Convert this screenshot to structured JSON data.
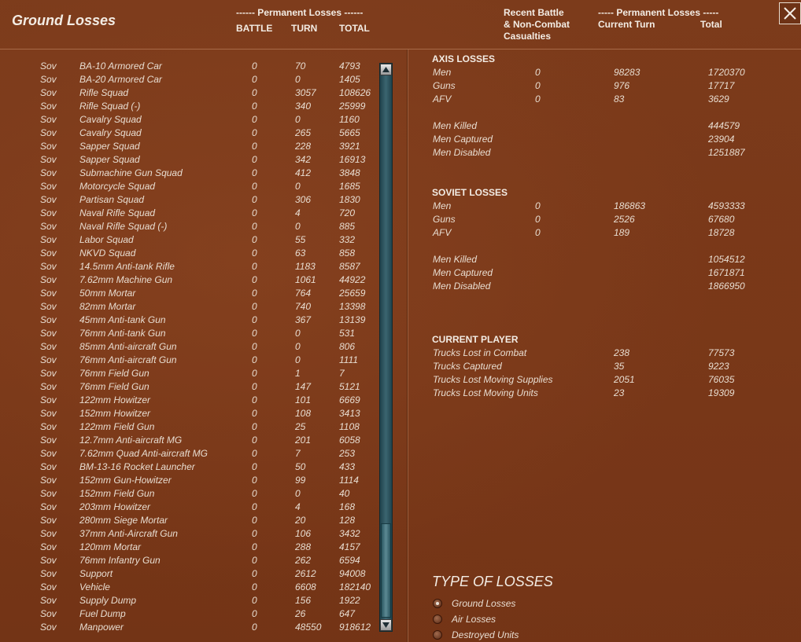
{
  "header": {
    "title": "Ground Losses",
    "perm_losses_label": "------ Permanent Losses ------",
    "col_battle": "BATTLE",
    "col_turn": "TURN",
    "col_total": "TOTAL",
    "recent_battle_line1": "Recent Battle",
    "recent_battle_line2": "& Non-Combat",
    "recent_battle_line3": "Casualties",
    "perm_losses_right": "----- Permanent Losses -----",
    "current_turn": "Current Turn",
    "total": "Total"
  },
  "close_icon": "close-x-icon",
  "units": [
    [
      "Sov",
      "BA-10 Armored Car",
      "0",
      "70",
      "4793"
    ],
    [
      "Sov",
      "BA-20 Armored Car",
      "0",
      "0",
      "1405"
    ],
    [
      "Sov",
      "Rifle Squad",
      "0",
      "3057",
      "108626"
    ],
    [
      "Sov",
      "Rifle Squad (-)",
      "0",
      "340",
      "25999"
    ],
    [
      "Sov",
      "Cavalry Squad",
      "0",
      "0",
      "1160"
    ],
    [
      "Sov",
      "Cavalry Squad",
      "0",
      "265",
      "5665"
    ],
    [
      "Sov",
      "Sapper Squad",
      "0",
      "228",
      "3921"
    ],
    [
      "Sov",
      "Sapper Squad",
      "0",
      "342",
      "16913"
    ],
    [
      "Sov",
      "Submachine Gun Squad",
      "0",
      "412",
      "3848"
    ],
    [
      "Sov",
      "Motorcycle Squad",
      "0",
      "0",
      "1685"
    ],
    [
      "Sov",
      "Partisan Squad",
      "0",
      "306",
      "1830"
    ],
    [
      "Sov",
      "Naval Rifle Squad",
      "0",
      "4",
      "720"
    ],
    [
      "Sov",
      "Naval Rifle Squad (-)",
      "0",
      "0",
      "885"
    ],
    [
      "Sov",
      "Labor Squad",
      "0",
      "55",
      "332"
    ],
    [
      "Sov",
      "NKVD Squad",
      "0",
      "63",
      "858"
    ],
    [
      "Sov",
      "14.5mm Anti-tank Rifle",
      "0",
      "1183",
      "8587"
    ],
    [
      "Sov",
      "7.62mm Machine Gun",
      "0",
      "1061",
      "44922"
    ],
    [
      "Sov",
      "50mm Mortar",
      "0",
      "764",
      "25659"
    ],
    [
      "Sov",
      "82mm Mortar",
      "0",
      "740",
      "13398"
    ],
    [
      "Sov",
      "45mm Anti-tank Gun",
      "0",
      "367",
      "13139"
    ],
    [
      "Sov",
      "76mm Anti-tank Gun",
      "0",
      "0",
      "531"
    ],
    [
      "Sov",
      "85mm Anti-aircraft Gun",
      "0",
      "0",
      "806"
    ],
    [
      "Sov",
      "76mm Anti-aircraft Gun",
      "0",
      "0",
      "1111"
    ],
    [
      "Sov",
      "76mm Field Gun",
      "0",
      "1",
      "7"
    ],
    [
      "Sov",
      "76mm Field Gun",
      "0",
      "147",
      "5121"
    ],
    [
      "Sov",
      "122mm Howitzer",
      "0",
      "101",
      "6669"
    ],
    [
      "Sov",
      "152mm Howitzer",
      "0",
      "108",
      "3413"
    ],
    [
      "Sov",
      "122mm Field Gun",
      "0",
      "25",
      "1108"
    ],
    [
      "Sov",
      "12.7mm Anti-aircraft MG",
      "0",
      "201",
      "6058"
    ],
    [
      "Sov",
      "7.62mm Quad Anti-aircraft MG",
      "0",
      "7",
      "253"
    ],
    [
      "Sov",
      "BM-13-16 Rocket Launcher",
      "0",
      "50",
      "433"
    ],
    [
      "Sov",
      "152mm Gun-Howitzer",
      "0",
      "99",
      "1114"
    ],
    [
      "Sov",
      "152mm Field Gun",
      "0",
      "0",
      "40"
    ],
    [
      "Sov",
      "203mm Howitzer",
      "0",
      "4",
      "168"
    ],
    [
      "Sov",
      "280mm Siege Mortar",
      "0",
      "20",
      "128"
    ],
    [
      "Sov",
      "37mm Anti-Aircraft Gun",
      "0",
      "106",
      "3432"
    ],
    [
      "Sov",
      "120mm Mortar",
      "0",
      "288",
      "4157"
    ],
    [
      "Sov",
      "76mm Infantry Gun",
      "0",
      "262",
      "6594"
    ],
    [
      "Sov",
      "Support",
      "0",
      "2612",
      "94008"
    ],
    [
      "Sov",
      "Vehicle",
      "0",
      "6608",
      "182140"
    ],
    [
      "Sov",
      "Supply Dump",
      "0",
      "156",
      "1922"
    ],
    [
      "Sov",
      "Fuel Dump",
      "0",
      "26",
      "647"
    ],
    [
      "Sov",
      "Manpower",
      "0",
      "48550",
      "918612"
    ]
  ],
  "axis": {
    "title": "AXIS LOSSES",
    "rows": [
      [
        "Men",
        "0",
        "98283",
        "1720370"
      ],
      [
        "Guns",
        "0",
        "976",
        "17717"
      ],
      [
        "AFV",
        "0",
        "83",
        "3629"
      ]
    ],
    "detail": [
      [
        "Men Killed",
        "444579"
      ],
      [
        "Men Captured",
        "23904"
      ],
      [
        "Men Disabled",
        "1251887"
      ]
    ]
  },
  "soviet": {
    "title": "SOVIET LOSSES",
    "rows": [
      [
        "Men",
        "0",
        "186863",
        "4593333"
      ],
      [
        "Guns",
        "0",
        "2526",
        "67680"
      ],
      [
        "AFV",
        "0",
        "189",
        "18728"
      ]
    ],
    "detail": [
      [
        "Men Killed",
        "1054512"
      ],
      [
        "Men Captured",
        "1671871"
      ],
      [
        "Men Disabled",
        "1866950"
      ]
    ]
  },
  "player": {
    "title": "CURRENT PLAYER",
    "rows": [
      [
        "Trucks Lost in Combat",
        "238",
        "77573"
      ],
      [
        "Trucks Captured",
        "35",
        "9223"
      ],
      [
        "Trucks Lost Moving Supplies",
        "2051",
        "76035"
      ],
      [
        "Trucks Lost Moving Units",
        "23",
        "19309"
      ]
    ]
  },
  "loss_types": {
    "title": "TYPE OF LOSSES",
    "options": [
      "Ground Losses",
      "Air Losses",
      "Destroyed Units"
    ],
    "selected": "Ground Losses"
  }
}
